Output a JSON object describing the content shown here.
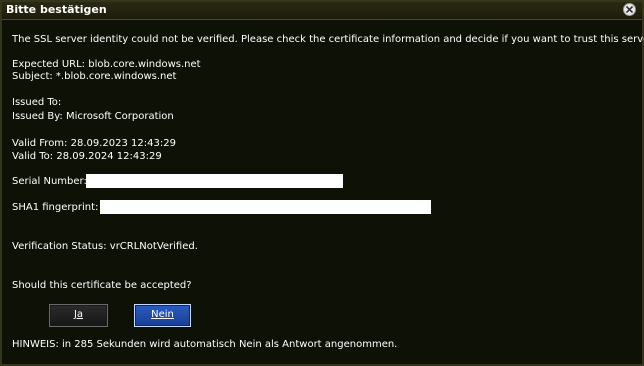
{
  "dialog": {
    "title": "Bitte bestätigen",
    "message": "The SSL server identity could not be verified. Please check the certificate information and decide if you want to trust this server.",
    "expected_url": "Expected URL: blob.core.windows.net",
    "subject": "Subject: *.blob.core.windows.net",
    "issued_to": "Issued To:",
    "issued_by": "Issued By: Microsoft Corporation",
    "valid_from": "Valid From: 28.09.2023 12:43:29",
    "valid_to": "Valid To: 28.09.2024 12:43:29",
    "serial_label": "Serial Number:",
    "sha1_label": "SHA1 fingerprint:",
    "verification_status": "Verification Status: vrCRLNotVerified.",
    "question": "Should this certificate be accepted?",
    "yes_label": "Ja",
    "no_label": "Nein",
    "notice": "HINWEIS: in 285 Sekunden wird automatisch Nein als Antwort angenommen."
  },
  "icons": {
    "close": "close-icon"
  },
  "colors": {
    "background": "#0e1206",
    "titlebar": "#1c1c0a",
    "text": "#ffffff",
    "default_button": "#1f4da8",
    "redaction": "#ffffff"
  }
}
